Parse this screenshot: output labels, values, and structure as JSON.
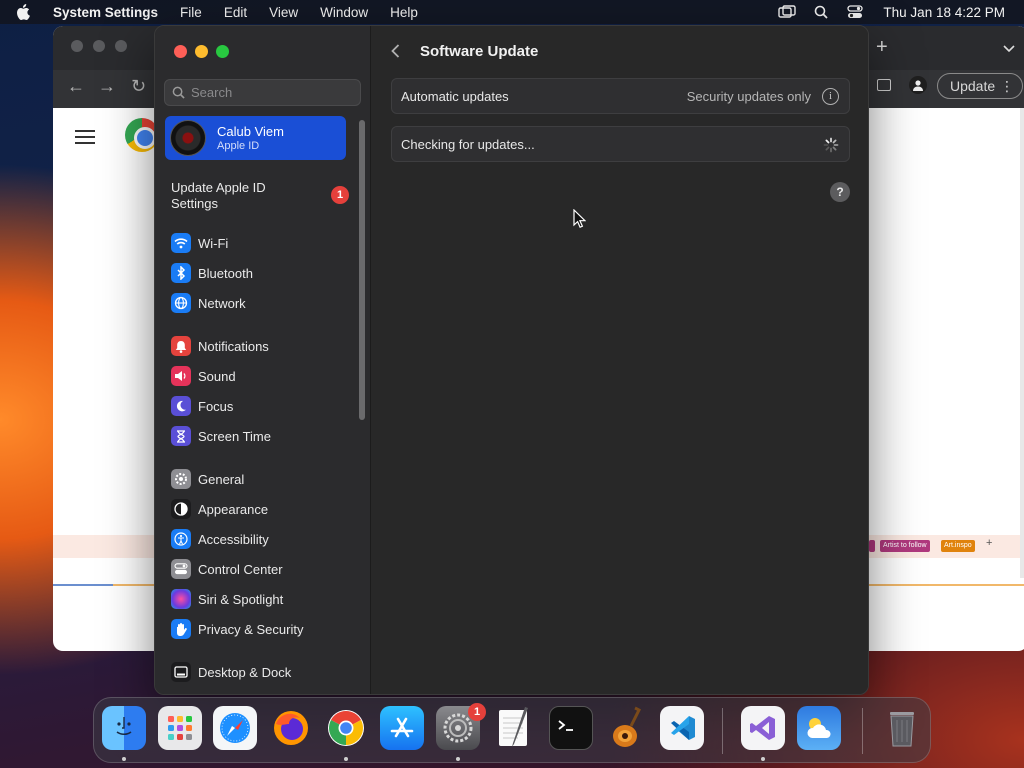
{
  "menubar": {
    "app_name": "System Settings",
    "items": [
      "File",
      "Edit",
      "View",
      "Window",
      "Help"
    ],
    "clock": "Thu Jan 18  4:22 PM",
    "icons": [
      "apple-icon",
      "screen-mirroring-icon",
      "spotlight-search-icon",
      "control-center-icon"
    ]
  },
  "browser": {
    "update_label": "Update",
    "chips": [
      "Artist to follow",
      "Art.inspo"
    ],
    "add_label": "+"
  },
  "sidebar": {
    "search_placeholder": "Search",
    "account": {
      "name": "Calub Viem",
      "subtitle": "Apple ID"
    },
    "update_apple_id": {
      "label": "Update Apple ID Settings",
      "badge": "1"
    },
    "items": [
      {
        "label": "Wi-Fi",
        "icon": "wifi-icon",
        "color": "#1a7cf5"
      },
      {
        "label": "Bluetooth",
        "icon": "bluetooth-icon",
        "color": "#1a7cf5"
      },
      {
        "label": "Network",
        "icon": "globe-icon",
        "color": "#1a7cf5"
      },
      {
        "label": "Notifications",
        "icon": "bell-icon",
        "color": "#e5433d"
      },
      {
        "label": "Sound",
        "icon": "speaker-icon",
        "color": "#e5335a"
      },
      {
        "label": "Focus",
        "icon": "moon-icon",
        "color": "#5a4fd6"
      },
      {
        "label": "Screen Time",
        "icon": "hourglass-icon",
        "color": "#5a4fd6"
      },
      {
        "label": "General",
        "icon": "gear-icon",
        "color": "#8e8e93"
      },
      {
        "label": "Appearance",
        "icon": "appearance-icon",
        "color": "#1c1c1e"
      },
      {
        "label": "Accessibility",
        "icon": "accessibility-icon",
        "color": "#1a7cf5"
      },
      {
        "label": "Control Center",
        "icon": "control-center-icon",
        "color": "#8e8e93"
      },
      {
        "label": "Siri & Spotlight",
        "icon": "siri-icon",
        "color": "#b53ad6"
      },
      {
        "label": "Privacy & Security",
        "icon": "hand-icon",
        "color": "#1a7cf5"
      },
      {
        "label": "Desktop & Dock",
        "icon": "dock-icon",
        "color": "#1c1c1e"
      }
    ]
  },
  "main": {
    "title": "Software Update",
    "automatic_updates": {
      "label": "Automatic updates",
      "value": "Security updates only"
    },
    "status": "Checking for updates...",
    "help_label": "?"
  },
  "dock": {
    "apps": [
      "Finder",
      "Launchpad",
      "Safari",
      "Firefox",
      "Google Chrome",
      "App Store",
      "System Settings",
      "TextEdit",
      "Terminal",
      "GarageBand",
      "Visual Studio Code",
      "Visual Studio",
      "Weather",
      "Trash"
    ],
    "settings_badge": "1"
  }
}
